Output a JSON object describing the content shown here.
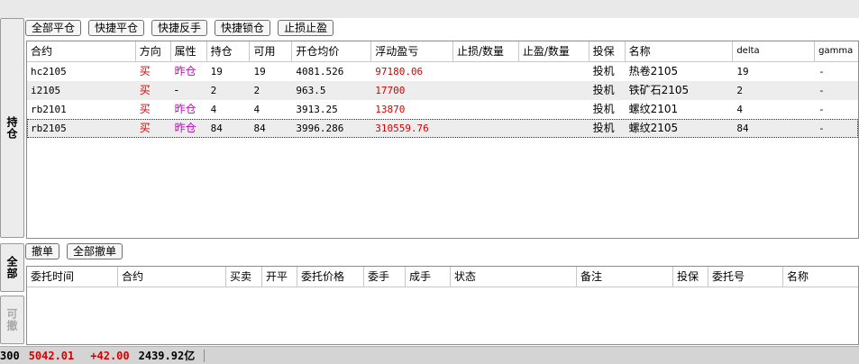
{
  "side_tabs": {
    "position": "持仓",
    "all": "全部",
    "cancelable": "可撤"
  },
  "position_toolbar": [
    "全部平仓",
    "快捷平仓",
    "快捷反手",
    "快捷锁仓",
    "止损止盈"
  ],
  "position_table": {
    "columns": [
      "合约",
      "方向",
      "属性",
      "持仓",
      "可用",
      "开仓均价",
      "浮动盈亏",
      "止损/数量",
      "止盈/数量",
      "投保",
      "名称",
      "delta",
      "gamma"
    ],
    "rows": [
      {
        "contract": "hc2105",
        "direction": "买",
        "attr": "昨仓",
        "position": "19",
        "available": "19",
        "avg_price": "4081.526",
        "pnl": "97180.06",
        "stop_loss": "",
        "take_profit": "",
        "hedge": "投机",
        "name": "热卷2105",
        "delta": "19",
        "gamma": "-"
      },
      {
        "contract": "i2105",
        "direction": "买",
        "attr": "-",
        "position": "2",
        "available": "2",
        "avg_price": "963.5",
        "pnl": "17700",
        "stop_loss": "",
        "take_profit": "",
        "hedge": "投机",
        "name": "铁矿石2105",
        "delta": "2",
        "gamma": "-"
      },
      {
        "contract": "rb2101",
        "direction": "买",
        "attr": "昨仓",
        "position": "4",
        "available": "4",
        "avg_price": "3913.25",
        "pnl": "13870",
        "stop_loss": "",
        "take_profit": "",
        "hedge": "投机",
        "name": "螺纹2101",
        "delta": "4",
        "gamma": "-"
      },
      {
        "contract": "rb2105",
        "direction": "买",
        "attr": "昨仓",
        "position": "84",
        "available": "84",
        "avg_price": "3996.286",
        "pnl": "310559.76",
        "stop_loss": "",
        "take_profit": "",
        "hedge": "投机",
        "name": "螺纹2105",
        "delta": "84",
        "gamma": "-"
      }
    ]
  },
  "order_toolbar": [
    "撤单",
    "全部撤单"
  ],
  "order_table": {
    "columns": [
      "委托时间",
      "合约",
      "买卖",
      "开平",
      "委托价格",
      "委手",
      "成手",
      "状态",
      "备注",
      "投保",
      "委托号",
      "名称"
    ]
  },
  "status_bar": {
    "index_code": "300",
    "price": "5042.01",
    "change": "+42.00",
    "amount": "2439.92亿"
  },
  "colors": {
    "up_red": "#d40000",
    "attr_purple": "#c000c0",
    "panel_gray": "#e9e9e9"
  }
}
